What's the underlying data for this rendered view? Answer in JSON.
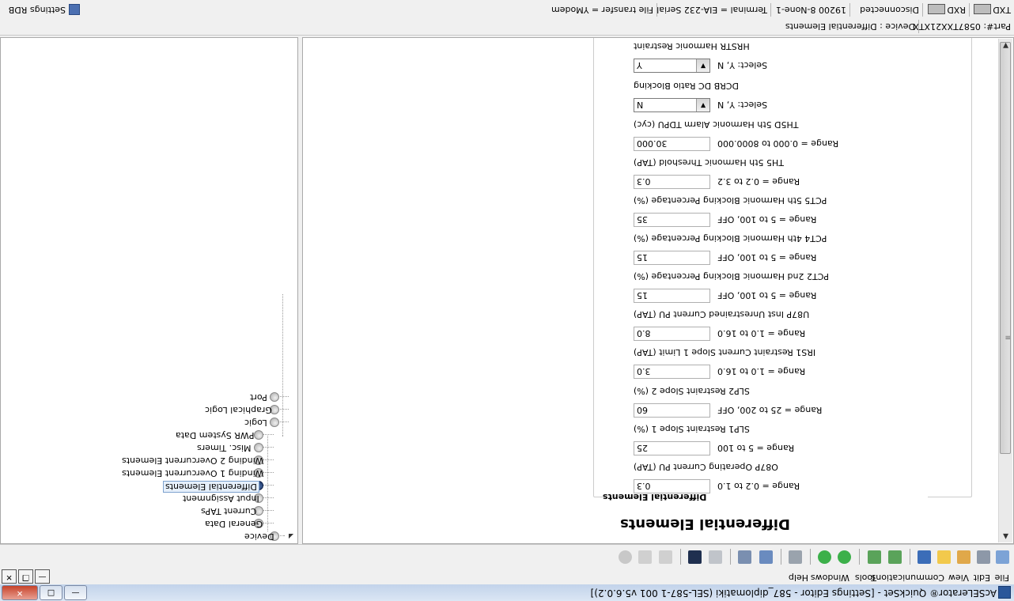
{
  "window": {
    "title": "AcSELerator® QuickSet - [Settings Editor - 587_diplomatiki (SEL-587-1 001 v5.6.0.2)]",
    "minimize": "—",
    "maximize": "□",
    "close": "✕"
  },
  "menu": {
    "items": [
      "File",
      "Edit",
      "View",
      "Communications",
      "Tools",
      "Windows",
      "Help"
    ],
    "mdi_minimize": "—",
    "mdi_restore": "❐",
    "mdi_close": "✕"
  },
  "toolbar": {
    "buttons": [
      "new-icon",
      "settings-icon",
      "read-icon",
      "open-icon",
      "save-icon",
      "import-icon",
      "export-icon",
      "upload-icon",
      "download-icon",
      "text-settings-icon",
      "terminal-icon",
      "transfer-icon",
      "meter-icon",
      "hmi-icon",
      "report-icon",
      "event-icon",
      "help-icon"
    ]
  },
  "editor": {
    "heading": "Differential Elements",
    "group_title": "Differential Elements",
    "settings": [
      {
        "label": "O87P  Operating Current PU (TAP)",
        "value": "0.3",
        "range": "Range = 0.2 to 1.0",
        "type": "input"
      },
      {
        "label": "SLP1  Restraint Slope 1 (%)",
        "value": "25",
        "range": "Range = 5 to 100",
        "type": "input"
      },
      {
        "label": "SLP2  Restraint Slope 2 (%)",
        "value": "60",
        "range": "Range = 25 to 200, OFF",
        "type": "input"
      },
      {
        "label": "IRS1  Restraint Current Slope 1 Limit (TAP)",
        "value": "3.0",
        "range": "Range = 1.0 to 16.0",
        "type": "input"
      },
      {
        "label": "U87P  Inst Unrestrained Current PU (TAP)",
        "value": "8.0",
        "range": "Range = 1.0 to 16.0",
        "type": "input"
      },
      {
        "label": "PCT2  2nd Harmonic Blocking Percentage (%)",
        "value": "15",
        "range": "Range = 5 to 100, OFF",
        "type": "input"
      },
      {
        "label": "PCT4  4th Harmonic Blocking Percentage (%)",
        "value": "15",
        "range": "Range = 5 to 100, OFF",
        "type": "input"
      },
      {
        "label": "PCT5  5th Harmonic Blocking Percentage (%)",
        "value": "35",
        "range": "Range = 5 to 100, OFF",
        "type": "input"
      },
      {
        "label": "TH5  5th Harmonic Threshold (TAP)",
        "value": "0.3",
        "range": "Range = 0.2 to 3.2",
        "type": "input"
      },
      {
        "label": "TH5D  5th Harmonic Alarm TDPU (cyc)",
        "value": "30.000",
        "range": "Range = 0.000 to 8000.000",
        "type": "input"
      },
      {
        "label": "DCRB  DC Ratio Blocking",
        "value": "N",
        "range": "Select: Y, N",
        "type": "select"
      },
      {
        "label": "HRSTR  Harmonic Restraint",
        "value": "Y",
        "range": "Select: Y, N",
        "type": "select"
      }
    ]
  },
  "tree": {
    "nodes": [
      {
        "label": "Device",
        "level": 0
      },
      {
        "label": "General Data",
        "level": 1
      },
      {
        "label": "Current TAPs",
        "level": 1
      },
      {
        "label": "Input Assignment",
        "level": 1
      },
      {
        "label": "Differential Elements",
        "level": 1,
        "selected": true
      },
      {
        "label": "Winding 1 Overcurrent Elements",
        "level": 1
      },
      {
        "label": "Winding 2 Overcurrent Elements",
        "level": 1
      },
      {
        "label": "Misc. Timers",
        "level": 1
      },
      {
        "label": "PWR System Data",
        "level": 1
      },
      {
        "label": "Logic",
        "level": 0
      },
      {
        "label": "Graphical Logic",
        "level": 0
      },
      {
        "label": "Port",
        "level": 0
      }
    ]
  },
  "statusbar_path": {
    "part_number": "Part#: 0587TXX21XTX",
    "device": "Device : Differential Elements"
  },
  "statusbar_comm": {
    "txd": "TXD",
    "rxd": "RXD",
    "connection": "Disconnected",
    "baud": "19200  8-None-1",
    "terminal": "Terminal = EIA-232 Serial",
    "file_transfer": "File transfer = YModem",
    "settings_rdb": "Settings RDB"
  }
}
